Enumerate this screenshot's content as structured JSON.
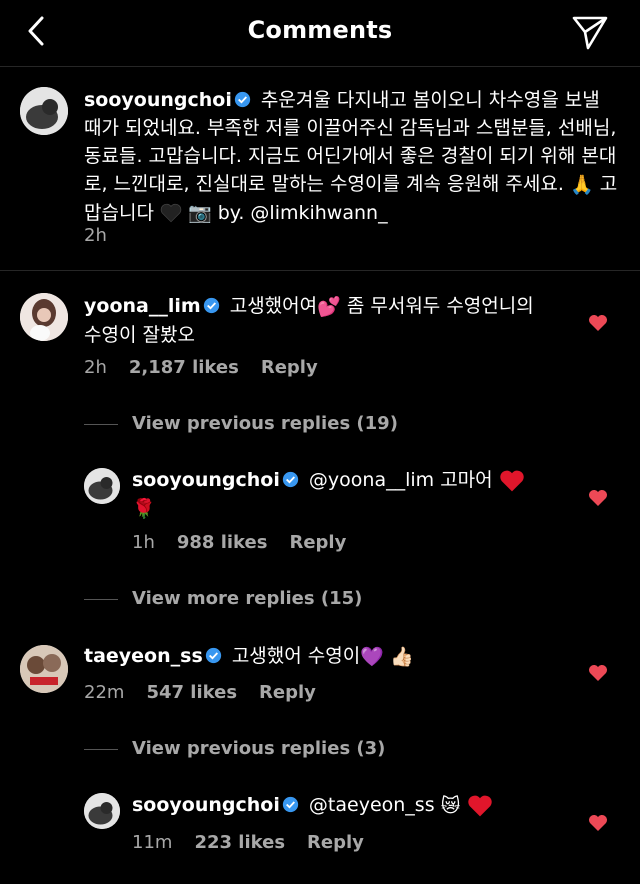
{
  "header": {
    "title": "Comments"
  },
  "caption": {
    "username": "sooyoungchoi",
    "text": "추운겨울 다지내고 봄이오니 차수영을 보낼 때가 되었네요. 부족한 저를 이끌어주신 감독님과 스탭분들, 선배님, 동료들. 고맙습니다. 지금도 어딘가에서 좋은 경찰이 되기 위해 본대로, 느낀대로, 진실대로 말하는 수영이를 계속 응원해 주세요.",
    "text_end": "고맙습니다",
    "credit": "by. @limkihwann_",
    "time": "2h"
  },
  "comments": [
    {
      "username": "yoona__lim",
      "text_a": "고생했어여",
      "text_b": "좀 무서워두 수영언니의",
      "text_c": "수영이 잘봤오",
      "time": "2h",
      "likes": "2,187 likes",
      "reply": "Reply",
      "view_replies": "View previous replies (19)"
    },
    {
      "username": "sooyoungchoi",
      "text": "@yoona__lim 고마어",
      "time": "1h",
      "likes": "988 likes",
      "reply": "Reply",
      "view_replies": "View more replies (15)"
    },
    {
      "username": "taeyeon_ss",
      "text": "고생했어 수영이",
      "time": "22m",
      "likes": "547 likes",
      "reply": "Reply",
      "view_replies": "View previous replies (3)"
    },
    {
      "username": "sooyoungchoi",
      "text": "@taeyeon_ss",
      "time": "11m",
      "likes": "223 likes",
      "reply": "Reply"
    }
  ],
  "colors": {
    "heart": "#ed4956",
    "verified": "#3897f0",
    "muted": "#a8a8a8"
  }
}
